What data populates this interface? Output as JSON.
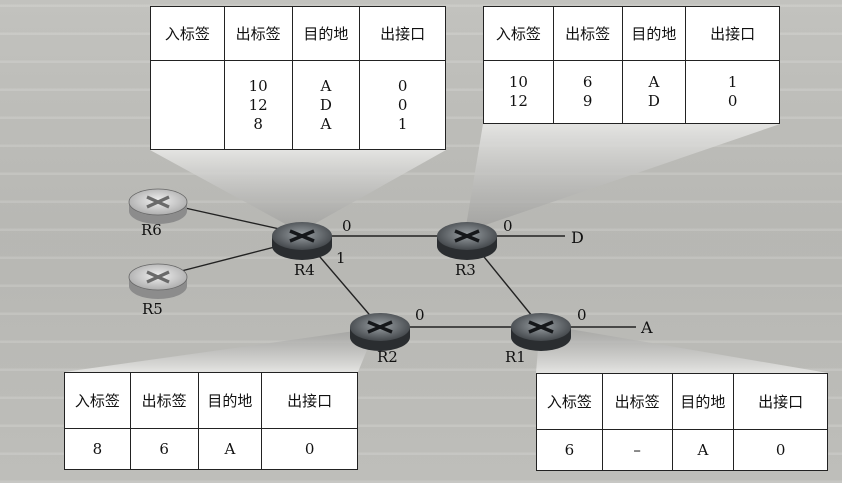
{
  "routers": {
    "r1": "R1",
    "r2": "R2",
    "r3": "R3",
    "r4": "R4",
    "r5": "R5",
    "r6": "R6"
  },
  "ports": {
    "r4_0": "0",
    "r4_1": "1",
    "r3_0": "0",
    "r2_0": "0",
    "r1_0": "0"
  },
  "destinations": {
    "d": "D",
    "a": "A"
  },
  "tables": {
    "r6": {
      "headers": [
        "入标签",
        "出标签",
        "目的地",
        "出接口"
      ],
      "rows": [
        [
          "",
          "10",
          "A",
          "0"
        ],
        [
          "",
          "12",
          "D",
          "0"
        ],
        [
          "",
          "8",
          "A",
          "1"
        ]
      ]
    },
    "r3": {
      "headers": [
        "入标签",
        "出标签",
        "目的地",
        "出接口"
      ],
      "rows": [
        [
          "10",
          "6",
          "A",
          "1"
        ],
        [
          "12",
          "9",
          "D",
          "0"
        ]
      ]
    },
    "r2": {
      "headers": [
        "入标签",
        "出标签",
        "目的地",
        "出接口"
      ],
      "rows": [
        [
          "8",
          "6",
          "A",
          "0"
        ]
      ]
    },
    "r1": {
      "headers": [
        "入标签",
        "出标签",
        "目的地",
        "出接口"
      ],
      "rows": [
        [
          "6",
          "–",
          "A",
          "0"
        ]
      ]
    }
  }
}
